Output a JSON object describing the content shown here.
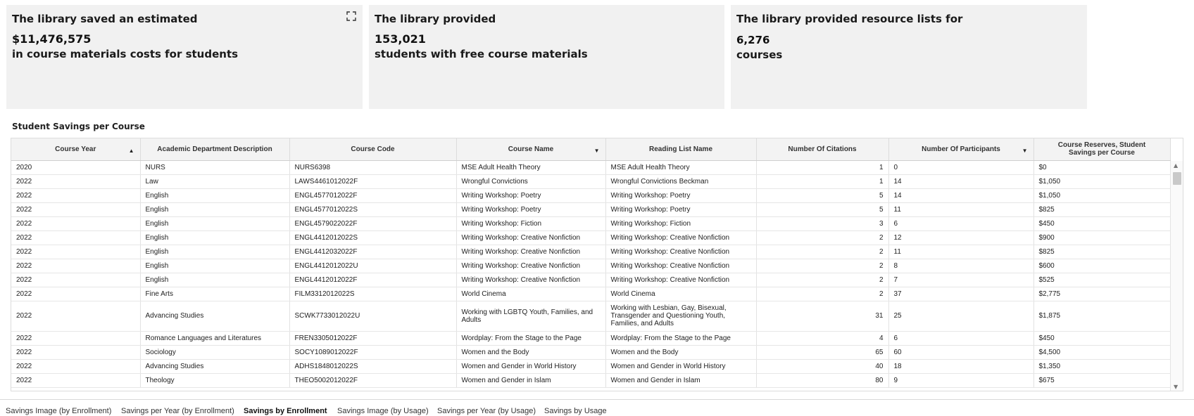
{
  "tiles": [
    {
      "line1": "The library saved an estimated",
      "value": "$11,476,575",
      "line3": "in course materials costs for students"
    },
    {
      "line1": "The library provided",
      "value": "153,021",
      "line3": "students with free course materials"
    },
    {
      "line1": "The library provided resource lists for",
      "value": "6,276",
      "line3": "courses"
    }
  ],
  "section_title": "Student Savings per Course",
  "table": {
    "headers": [
      "Course Year",
      "Academic Department Description",
      "Course Code",
      "Course Name",
      "Reading List Name",
      "Number Of Citations",
      "Number Of Participants",
      "Course Reserves, Student Savings per Course"
    ],
    "rows": [
      [
        "2020",
        "NURS",
        "NURS6398",
        "MSE Adult Health Theory",
        "MSE Adult Health Theory",
        "1",
        "0",
        "$0"
      ],
      [
        "2022",
        "Law",
        "LAWS4461012022F",
        "Wrongful Convictions",
        "Wrongful Convictions Beckman",
        "1",
        "14",
        "$1,050"
      ],
      [
        "2022",
        "English",
        "ENGL4577012022F",
        "Writing Workshop: Poetry",
        "Writing Workshop: Poetry",
        "5",
        "14",
        "$1,050"
      ],
      [
        "2022",
        "English",
        "ENGL4577012022S",
        "Writing Workshop: Poetry",
        "Writing Workshop: Poetry",
        "5",
        "11",
        "$825"
      ],
      [
        "2022",
        "English",
        "ENGL4579022022F",
        "Writing Workshop: Fiction",
        "Writing Workshop: Fiction",
        "3",
        "6",
        "$450"
      ],
      [
        "2022",
        "English",
        "ENGL4412012022S",
        "Writing Workshop: Creative Nonfiction",
        "Writing Workshop: Creative Nonfiction",
        "2",
        "12",
        "$900"
      ],
      [
        "2022",
        "English",
        "ENGL4412032022F",
        "Writing Workshop: Creative Nonfiction",
        "Writing Workshop: Creative Nonfiction",
        "2",
        "11",
        "$825"
      ],
      [
        "2022",
        "English",
        "ENGL4412012022U",
        "Writing Workshop: Creative Nonfiction",
        "Writing Workshop: Creative Nonfiction",
        "2",
        "8",
        "$600"
      ],
      [
        "2022",
        "English",
        "ENGL4412012022F",
        "Writing Workshop: Creative Nonfiction",
        "Writing Workshop: Creative Nonfiction",
        "2",
        "7",
        "$525"
      ],
      [
        "2022",
        "Fine Arts",
        "FILM3312012022S",
        "World Cinema",
        "World Cinema",
        "2",
        "37",
        "$2,775"
      ],
      [
        "2022",
        "Advancing Studies",
        "SCWK7733012022U",
        "Working with LGBTQ Youth, Families, and Adults",
        "Working with Lesbian, Gay, Bisexual, Transgender and Questioning Youth, Families, and Adults",
        "31",
        "25",
        "$1,875"
      ],
      [
        "2022",
        "Romance Languages and Literatures",
        "FREN3305012022F",
        "Wordplay: From the Stage to the Page",
        "Wordplay: From the Stage to the Page",
        "4",
        "6",
        "$450"
      ],
      [
        "2022",
        "Sociology",
        "SOCY1089012022F",
        "Women and the Body",
        "Women and the Body",
        "65",
        "60",
        "$4,500"
      ],
      [
        "2022",
        "Advancing Studies",
        "ADHS1848012022S",
        "Women and Gender in World History",
        "Women and Gender in World History",
        "40",
        "18",
        "$1,350"
      ],
      [
        "2022",
        "Theology",
        "THEO5002012022F",
        "Women and Gender in Islam",
        "Women and Gender in Islam",
        "80",
        "9",
        "$675"
      ]
    ]
  },
  "tabs": [
    "Savings Image (by Enrollment)",
    "Savings per Year (by Enrollment)",
    "Savings by Enrollment",
    "Savings Image (by Usage)",
    "Savings per Year (by Usage)",
    "Savings by Usage"
  ],
  "active_tab": "Savings by Enrollment"
}
